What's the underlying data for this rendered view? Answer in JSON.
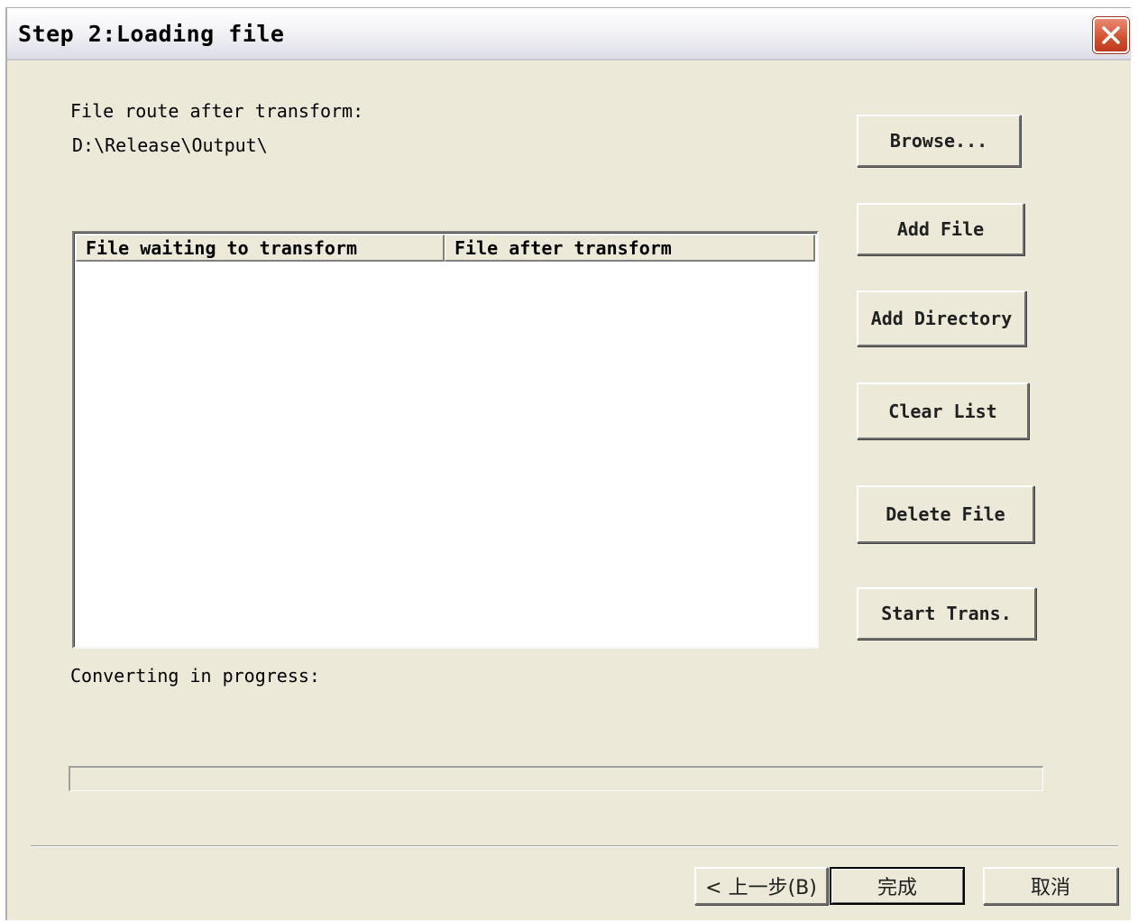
{
  "window": {
    "title": "Step 2:Loading file"
  },
  "output": {
    "label": "File route after transform:",
    "path": "D:\\Release\\Output\\"
  },
  "list": {
    "columns": [
      "File waiting to transform",
      "File after transform"
    ],
    "rows": []
  },
  "buttons": {
    "browse": "Browse...",
    "add_file": "Add File",
    "add_directory": "Add Directory",
    "clear_list": "Clear List",
    "delete_file": "Delete File",
    "start_trans": "Start Trans."
  },
  "progress": {
    "label": "Converting in progress:",
    "value": 0
  },
  "footer": {
    "back": "< 上一步(B)",
    "finish": "完成",
    "cancel": "取消"
  },
  "icons": {
    "close": "close-icon"
  }
}
